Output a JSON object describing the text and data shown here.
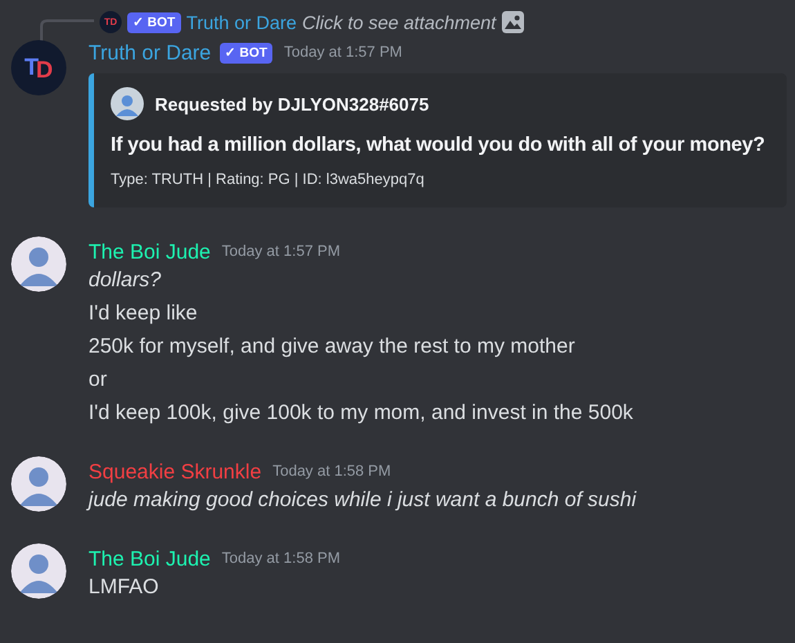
{
  "reply": {
    "avatar_text": "TD",
    "badge": "✓ BOT",
    "author": "Truth or Dare",
    "text": "Click to see attachment"
  },
  "messages": [
    {
      "kind": "bot",
      "avatar_text": "TD",
      "author": "Truth or Dare",
      "color": "#3ba5e0",
      "badge": "✓ BOT",
      "time": "Today at 1:57 PM",
      "embed": {
        "requester": "Requested by DJLYON328#6075",
        "question": "If you had a million dollars, what would you do with all of your money?",
        "footer": "Type: TRUTH | Rating: PG | ID: l3wa5heypq7q"
      }
    },
    {
      "kind": "user",
      "author": "The Boi Jude",
      "color": "#1df2b0",
      "time": "Today at 1:57 PM",
      "lines": [
        {
          "text": "dollars?",
          "italic": true
        },
        {
          "text": "I'd keep like",
          "italic": false
        },
        {
          "text": "250k for myself, and give away the rest to my mother",
          "italic": false
        },
        {
          "text": "or",
          "italic": false
        },
        {
          "text": "I'd keep 100k, give 100k to my mom, and invest in the 500k",
          "italic": false
        }
      ]
    },
    {
      "kind": "user",
      "author": "Squeakie Skrunkle",
      "color": "#f23f43",
      "time": "Today at 1:58 PM",
      "lines": [
        {
          "text": "jude making good choices while i just want a bunch of sushi",
          "italic": true
        }
      ]
    },
    {
      "kind": "user",
      "author": "The Boi Jude",
      "color": "#1df2b0",
      "time": "Today at 1:58 PM",
      "lines": [
        {
          "text": "LMFAO",
          "italic": false
        }
      ]
    }
  ]
}
